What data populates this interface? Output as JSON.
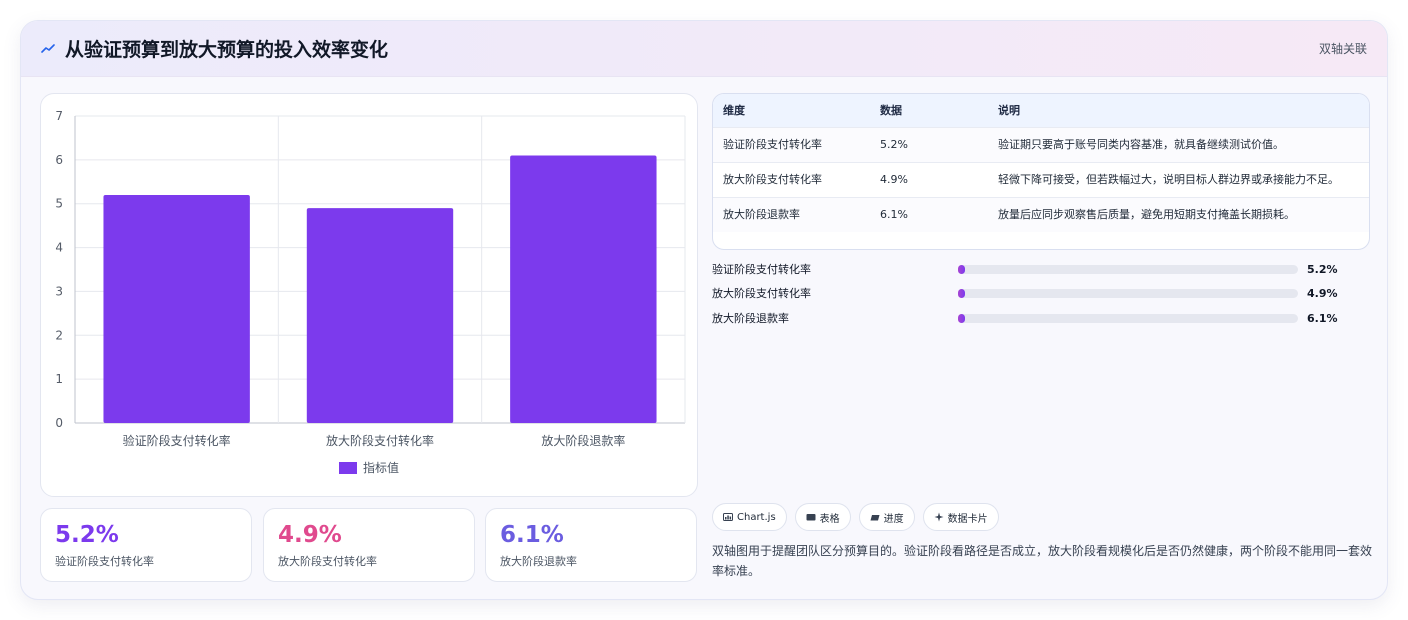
{
  "header": {
    "title": "从验证预算到放大预算的投入效率变化",
    "badge": "双轴关联",
    "icon": "trend-icon"
  },
  "colors": {
    "bar": "#7c3aed",
    "kpi_1": "#7c3aed",
    "kpi_2": "#e04a8e",
    "kpi_3": "#6b5de0"
  },
  "chart_data": {
    "type": "bar",
    "categories": [
      "验证阶段支付转化率",
      "放大阶段支付转化率",
      "放大阶段退款率"
    ],
    "series": [
      {
        "name": "指标值",
        "values": [
          5.2,
          4.9,
          6.1
        ]
      }
    ],
    "ylim": [
      0,
      7
    ],
    "yticks": [
      0,
      1,
      2,
      3,
      4,
      5,
      6,
      7
    ],
    "grid": true,
    "legend": "bottom"
  },
  "kpis": [
    {
      "value": "5.2%",
      "label": "验证阶段支付转化率"
    },
    {
      "value": "4.9%",
      "label": "放大阶段支付转化率"
    },
    {
      "value": "6.1%",
      "label": "放大阶段退款率"
    }
  ],
  "table": {
    "headers": [
      "维度",
      "数据",
      "说明"
    ],
    "rows": [
      [
        "验证阶段支付转化率",
        "5.2%",
        "验证期只要高于账号同类内容基准，就具备继续测试价值。"
      ],
      [
        "放大阶段支付转化率",
        "4.9%",
        "轻微下降可接受，但若跌幅过大，说明目标人群边界或承接能力不足。"
      ],
      [
        "放大阶段退款率",
        "6.1%",
        "放量后应同步观察售后质量，避免用短期支付掩盖长期损耗。"
      ]
    ]
  },
  "progress": [
    {
      "label": "验证阶段支付转化率",
      "value": "5.2%",
      "fill": 0.02
    },
    {
      "label": "放大阶段支付转化率",
      "value": "4.9%",
      "fill": 0.02
    },
    {
      "label": "放大阶段退款率",
      "value": "6.1%",
      "fill": 0.02
    }
  ],
  "chips": [
    {
      "icon": "chart-icon",
      "label": "Chart.js"
    },
    {
      "icon": "table-icon",
      "label": "表格"
    },
    {
      "icon": "progress-icon",
      "label": "进度"
    },
    {
      "icon": "sparkle-icon",
      "label": "数据卡片"
    }
  ],
  "note": "双轴图用于提醒团队区分预算目的。验证阶段看路径是否成立，放大阶段看规模化后是否仍然健康，两个阶段不能用同一套效率标准。"
}
